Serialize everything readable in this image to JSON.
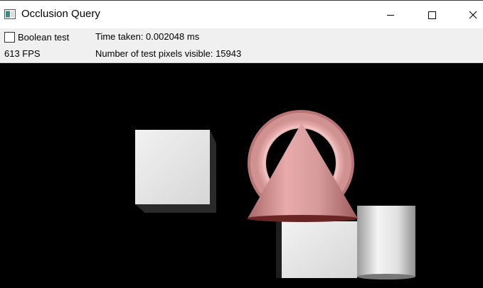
{
  "window": {
    "title": "Occlusion Query",
    "app_icon": "app-window-icon",
    "controls": [
      "minimize-icon",
      "maximize-icon",
      "close-icon"
    ]
  },
  "controls": {
    "boolean_test": {
      "label": "Boolean test",
      "checked": false
    },
    "time_taken": "Time taken: 0.002048 ms",
    "fps": "613 FPS",
    "pixels_visible": "Number of test pixels visible: 15943"
  },
  "scene": {
    "background": "#000000",
    "objects": [
      "cube",
      "torus",
      "cone",
      "cube",
      "cylinder"
    ],
    "colors": {
      "cube": "#e6e6e6",
      "torus": "#e8a8a8",
      "cone": "#c98686"
    }
  }
}
